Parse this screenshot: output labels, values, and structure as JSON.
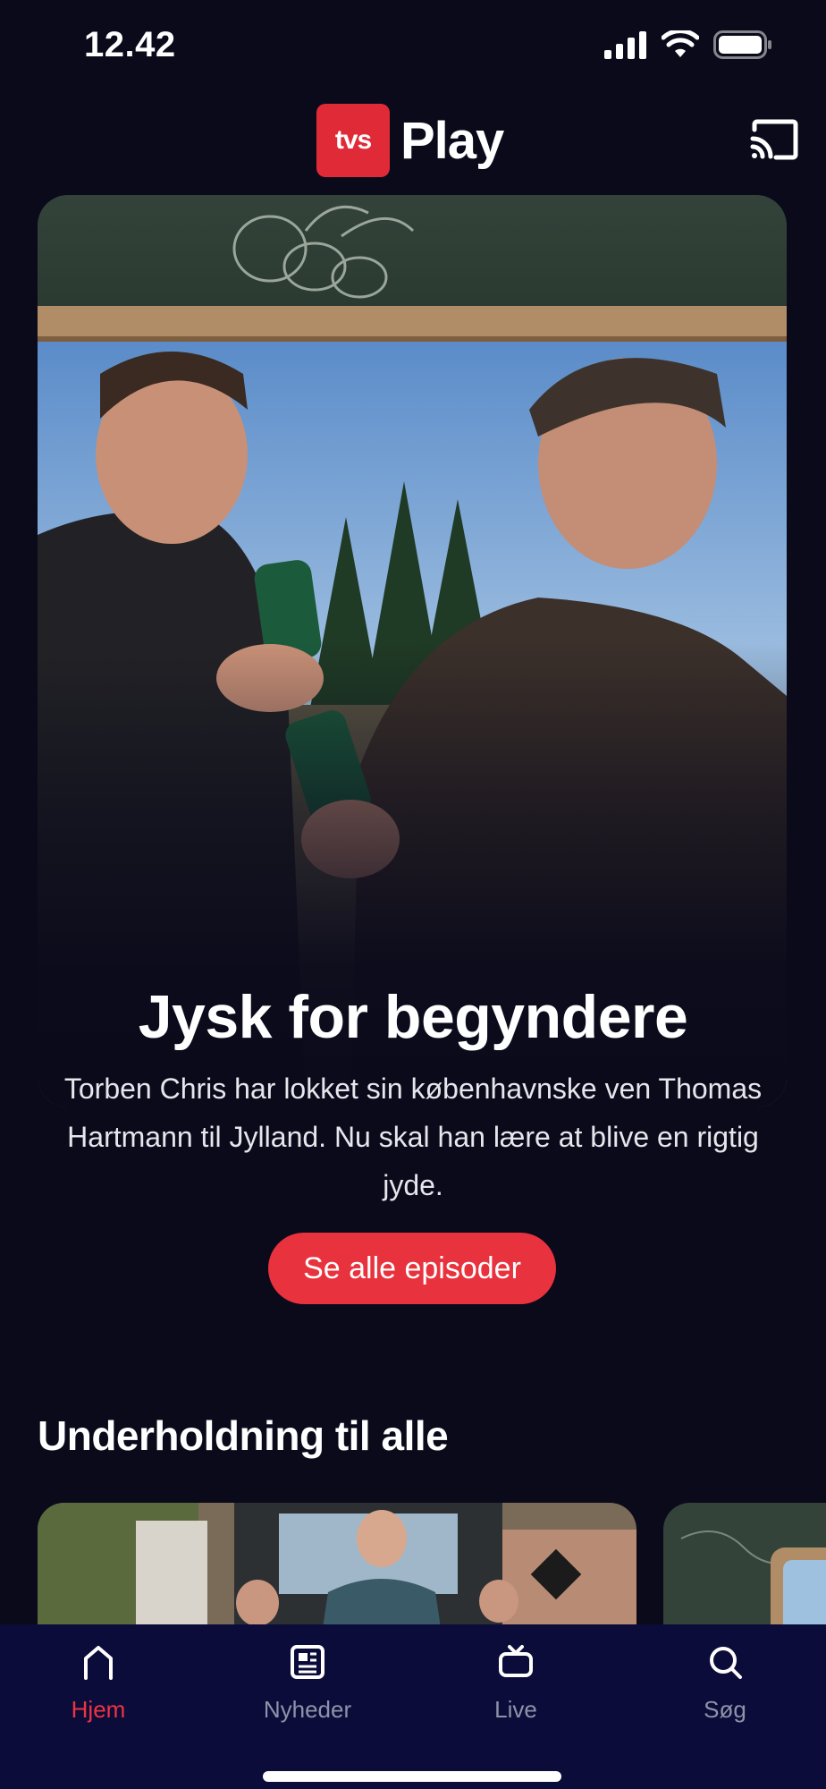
{
  "status_bar": {
    "time": "12.42",
    "icons": [
      "signal-icon",
      "wifi-icon",
      "battery-icon"
    ]
  },
  "header": {
    "logo_badge": "tvs",
    "logo_word": "Play",
    "cast_icon": "cast-icon"
  },
  "hero": {
    "image_description_icon": "hero-photo",
    "title": "Jysk for begyndere",
    "description": "Torben Chris har lokket sin københavnske ven Thomas Hartmann til Jylland. Nu skal han lære at blive en rigtig jyde.",
    "cta_label": "Se alle episoder"
  },
  "section": {
    "title": "Underholdning til alle",
    "cards": [
      {
        "icon": "show-thumbnail"
      },
      {
        "icon": "show-thumbnail"
      }
    ]
  },
  "tab_bar": {
    "items": [
      {
        "label": "Hjem",
        "icon": "home-icon",
        "active": true
      },
      {
        "label": "Nyheder",
        "icon": "news-icon",
        "active": false
      },
      {
        "label": "Live",
        "icon": "tv-icon",
        "active": false
      },
      {
        "label": "Søg",
        "icon": "search-icon",
        "active": false
      }
    ]
  },
  "colors": {
    "background": "#0a0a1b",
    "accent": "#e8323d",
    "tab_bar": "#0b0c3a",
    "inactive_tab": "#8f93a8"
  }
}
